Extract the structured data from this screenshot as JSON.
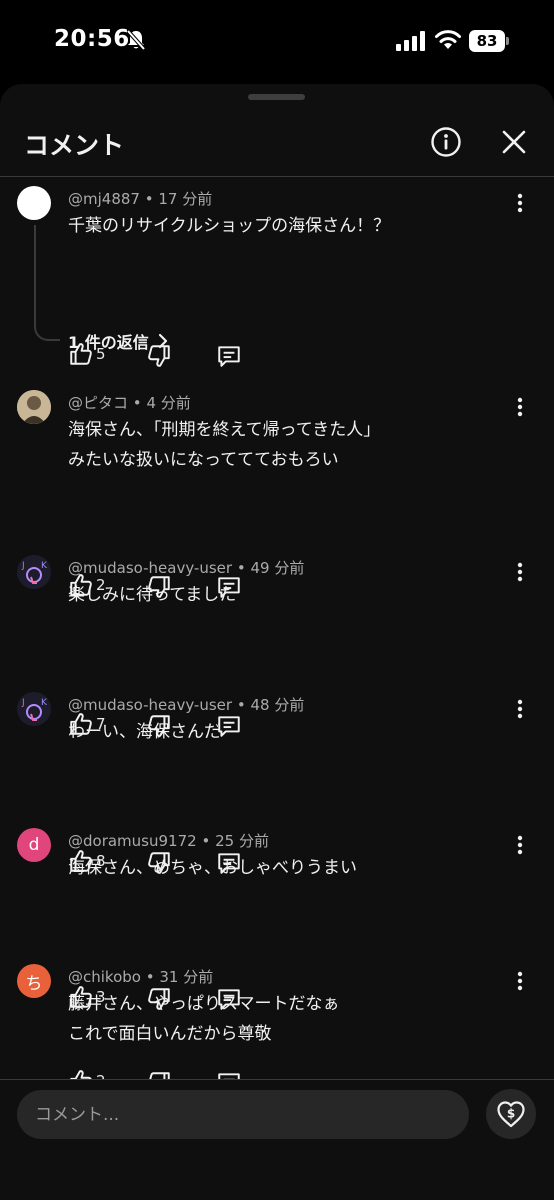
{
  "status_bar": {
    "time": "20:56",
    "battery": "83"
  },
  "sheet": {
    "title": "コメント"
  },
  "comments": [
    {
      "author": "@mj4887",
      "age": "17 分前",
      "lines": [
        "千葉のリサイクルショップの海保さん！？"
      ],
      "likes": "5",
      "avatar_color": "#ffffff",
      "avatar_letter": ""
    },
    {
      "author": "@ピタコ",
      "age": "4 分前",
      "lines": [
        "海保さん、「刑期を終えて帰ってきた人」",
        "みたいな扱いになっててておもろい"
      ],
      "likes": "2",
      "avatar_color": "#b9a58a",
      "avatar_letter": ""
    },
    {
      "author": "@mudaso-heavy-user",
      "age": "49 分前",
      "lines": [
        "楽しみに待ってました"
      ],
      "likes": "7",
      "avatar_color": "#1c1c2a",
      "avatar_letter": ""
    },
    {
      "author": "@mudaso-heavy-user",
      "age": "48 分前",
      "lines": [
        "わーい、海保さんだ"
      ],
      "likes": "8",
      "avatar_color": "#1c1c2a",
      "avatar_letter": ""
    },
    {
      "author": "@doramusu9172",
      "age": "25 分前",
      "lines": [
        "海保さん、めちゃ、おしゃべりうまい"
      ],
      "likes": "3",
      "avatar_color": "#e0457b",
      "avatar_letter": "d"
    },
    {
      "author": "@chikobo",
      "age": "31 分前",
      "lines": [
        "藤井さん、やっぱりスマートだなぁ",
        "これで面白いんだから尊敬"
      ],
      "likes": "2",
      "avatar_color": "#e8613a",
      "avatar_letter": "ち"
    }
  ],
  "replies_link": {
    "label": "1 件の返信"
  },
  "meta_separator": "•",
  "input": {
    "placeholder": "コメント..."
  }
}
